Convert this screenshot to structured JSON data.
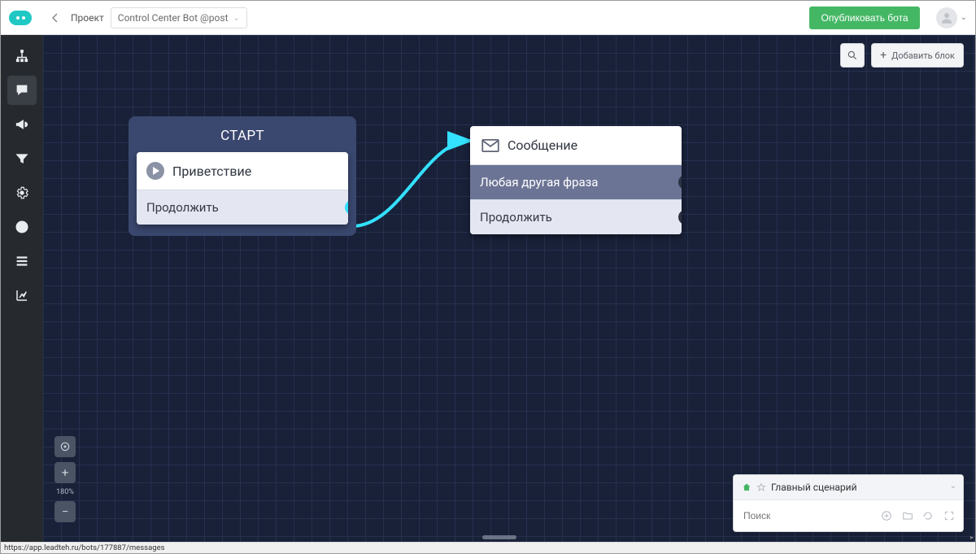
{
  "header": {
    "breadcrumb": "Проект",
    "bot_name": "Control Center Bot @post",
    "publish_label": "Опубликовать бота"
  },
  "sidebar": {
    "tooltip_messages": "Сообщения"
  },
  "toolbar": {
    "add_block_label": "Добавить блок"
  },
  "zoom": {
    "level": "180%"
  },
  "nodes": {
    "start": {
      "title": "СТАРТ",
      "greeting_label": "Приветствие",
      "continue_label": "Продолжить"
    },
    "message": {
      "title": "Сообщение",
      "any_phrase_label": "Любая другая фраза",
      "continue_label": "Продолжить"
    }
  },
  "palette": {
    "title": "Главный сценарий",
    "search_placeholder": "Поиск"
  },
  "status": {
    "url": "https://app.leadteh.ru/bots/177887/messages"
  }
}
